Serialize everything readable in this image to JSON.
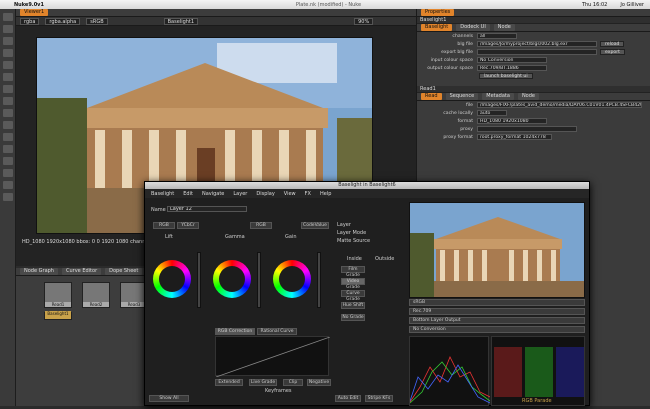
{
  "menubar": {
    "app": "Nuke9.0v1",
    "title": "Plate.nk (modified) - Nuke",
    "time": "Thu 16:02",
    "user": "Jo Gilliver"
  },
  "viewer": {
    "tab": "Viewer1",
    "layer": "rgba",
    "alpha": "rgba.alpha",
    "display": "sRGB",
    "node": "Baselight1",
    "zoom": "90%",
    "info": "HD_1080 1920x1080  bbox: 0 0 1920 1080 channels: rgba"
  },
  "dag": {
    "tabs": [
      "Node Graph",
      "Curve Editor",
      "Dope Sheet"
    ],
    "nodes": [
      "Read1",
      "Read2",
      "Read3"
    ],
    "label": "Baselight1"
  },
  "props": {
    "header": "Properties",
    "baselight": {
      "title": "Baselight1",
      "tabs": [
        "Baselight",
        "Dodeck UI",
        "Node"
      ],
      "rows": [
        {
          "label": "channels",
          "value": "all"
        },
        {
          "label": "blg file",
          "value": "/Images/Jo/myproject/blgs/002.blg.exr",
          "button": "reload"
        },
        {
          "label": "export blg file",
          "value": "",
          "button": "export"
        },
        {
          "label": "input colour space",
          "value": "No Conversion"
        },
        {
          "label": "output colour space",
          "value": "Rec.709/BT.1886"
        }
      ],
      "launch": "launch baselight ui"
    },
    "read": {
      "title": "Read1",
      "tabs": [
        "Read",
        "Sequence",
        "Metadata",
        "Node"
      ],
      "rows": [
        {
          "label": "file",
          "value": "/Images/FIXF/plates_avid_demo/media/DAY06.C01V01.4PCB.4SFCB420C_29fe480b.mxf"
        },
        {
          "label": "cache locally",
          "value": "auto"
        },
        {
          "label": "format",
          "value": "HD_1080 1920x1080"
        },
        {
          "label": "proxy",
          "value": ""
        },
        {
          "label": "proxy format",
          "value": "root.proxy_format 1024x778"
        }
      ]
    }
  },
  "baselight": {
    "window_title": "Baselight in Baselight6",
    "menu": [
      "Baselight",
      "Edit",
      "Navigate",
      "Layer",
      "Display",
      "View",
      "FX",
      "Help"
    ],
    "name_label": "Name",
    "name_value": "Layer 12",
    "space": "RGB",
    "mode": "YCbCr",
    "space2": "RGB",
    "cust": "CodeValue",
    "wheels": [
      "Lift",
      "Gamma",
      "Gain"
    ],
    "buttons": [
      "RGB Correction",
      "Rational Curve",
      "Extended",
      "Live Grade",
      "Clip",
      "Negative"
    ],
    "keyframes": "Keyframes",
    "show": "Show All",
    "auto": "Auto Edit",
    "stripe": "Stripe KFs",
    "layer_labels": [
      "Layer",
      "Layer Mode",
      "Matte Source"
    ],
    "inside": "Inside",
    "outside": "Outside",
    "grade_buttons": [
      "Film Grade",
      "Video Grade",
      "Curve Grade",
      "Hue Shift",
      "No Grade"
    ],
    "right_rows": [
      "sRGB",
      "Rec.709",
      "Bottom Layer Output",
      "No Conversion"
    ],
    "scope_label": "RGB Parade"
  }
}
